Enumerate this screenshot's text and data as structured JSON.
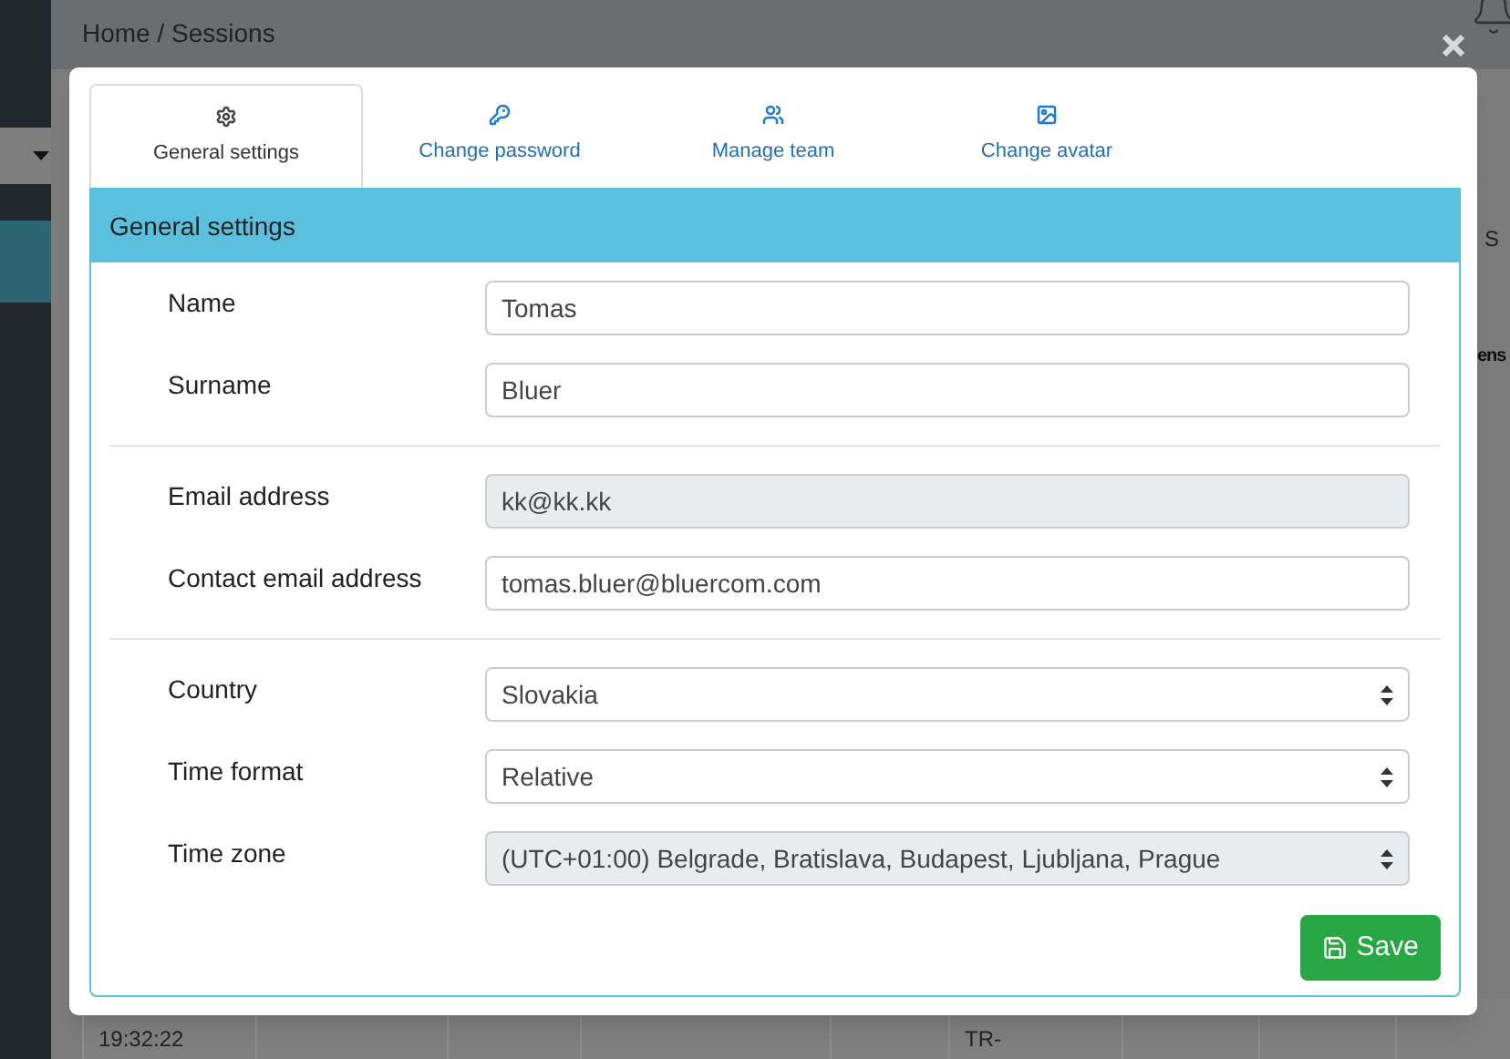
{
  "page": {
    "breadcrumb": "Home / Sessions",
    "right_column": [
      "S",
      "ens"
    ],
    "table_row": {
      "first_cell": "19:32:22",
      "sixth_cell": "TR-"
    }
  },
  "modal": {
    "tabs": [
      {
        "label": "General settings",
        "selected": true
      },
      {
        "label": "Change password",
        "selected": false
      },
      {
        "label": "Manage team",
        "selected": false
      },
      {
        "label": "Change avatar",
        "selected": false
      }
    ],
    "panel_title": "General settings",
    "sections": [
      {
        "fields": [
          {
            "label": "Name",
            "kind": "text",
            "value": "Tomas",
            "disabled": false
          },
          {
            "label": "Surname",
            "kind": "text",
            "value": "Bluer",
            "disabled": false
          }
        ]
      },
      {
        "fields": [
          {
            "label": "Email address",
            "kind": "text",
            "value": "kk@kk.kk",
            "disabled": true
          },
          {
            "label": "Contact email address",
            "kind": "text",
            "value": "tomas.bluer@bluercom.com",
            "disabled": false
          }
        ]
      },
      {
        "fields": [
          {
            "label": "Country",
            "kind": "select",
            "value": "Slovakia",
            "disabled": false
          },
          {
            "label": "Time format",
            "kind": "select",
            "value": "Relative",
            "disabled": false
          },
          {
            "label": "Time zone",
            "kind": "select",
            "value": "(UTC+01:00) Belgrade, Bratislava, Budapest, Ljubljana, Prague",
            "disabled": true
          }
        ]
      }
    ],
    "save_button": "Save"
  }
}
